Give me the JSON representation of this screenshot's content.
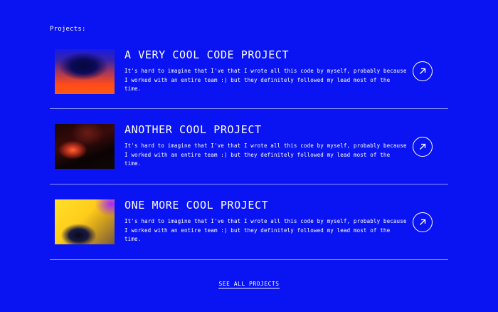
{
  "section": {
    "label": "Projects:"
  },
  "projects": [
    {
      "title": "A VERY COOL CODE PROJECT",
      "description": "It's hard to imagine that I've that I wrote all this code by myself, probably because I worked with an entire team :) but they definitely followed my lead most of the time.",
      "icon": "arrow-up-right-icon"
    },
    {
      "title": "ANOTHER COOL PROJECT",
      "description": "It's hard to imagine that I've that I wrote all this code by myself, probably because I worked with an entire team :) but they definitely followed my lead most of the time.",
      "icon": "arrow-up-right-icon"
    },
    {
      "title": "ONE MORE COOL PROJECT",
      "description": "It's hard to imagine that I've that I wrote all this code by myself, probably because I worked with an entire team :) but they definitely followed my lead most of the time.",
      "icon": "arrow-up-right-icon"
    }
  ],
  "footer": {
    "see_all_label": "SEE ALL PROJECTS"
  },
  "colors": {
    "background": "#0a14f2",
    "text": "#ffffff"
  }
}
